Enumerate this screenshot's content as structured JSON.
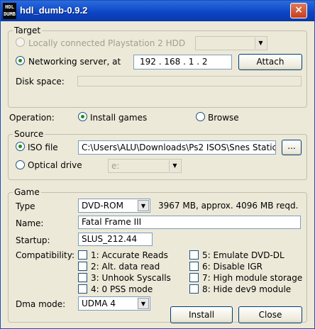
{
  "window": {
    "title": "hdl_dumb-0.9.2",
    "icon_text": "HDL DUMB",
    "close_glyph": "×"
  },
  "target": {
    "legend": "Target",
    "local_hdd_label": "Locally connected Playstation 2 HDD",
    "network_label": "Networking server, at",
    "ip": [
      "192",
      "168",
      "1",
      "2"
    ],
    "attach_label": "Attach",
    "disk_space_label": "Disk space:"
  },
  "operation": {
    "label": "Operation:",
    "install_label": "Install games",
    "browse_label": "Browse",
    "selected": "install"
  },
  "source": {
    "legend": "Source",
    "iso_label": "ISO file",
    "iso_path": "C:\\Users\\ALU\\Downloads\\Ps2 ISOS\\Snes Static",
    "browse_button": "...",
    "optical_label": "Optical drive",
    "optical_value": "e:"
  },
  "game": {
    "legend": "Game",
    "type_label": "Type",
    "type_value": "DVD-ROM",
    "size_text": "3967 MB, approx. 4096 MB reqd.",
    "name_label": "Name:",
    "name_value": "Fatal Frame III",
    "startup_label": "Startup:",
    "startup_value": "SLUS_212.44",
    "compat_label": "Compatibility:",
    "compat_left": [
      "1: Accurate Reads",
      "2: Alt. data read",
      "3: Unhook Syscalls",
      "4: 0 PSS mode"
    ],
    "compat_right": [
      "5: Emulate DVD-DL",
      "6: Disable IGR",
      "7: High module storage",
      "8: Hide dev9 module"
    ],
    "dma_label": "Dma mode:",
    "dma_value": "UDMA 4"
  },
  "actions": {
    "install_label": "Install",
    "close_label": "Close"
  },
  "colors": {
    "titlebar": "#0b44c4",
    "radio_dot": "#1d8c1d"
  }
}
